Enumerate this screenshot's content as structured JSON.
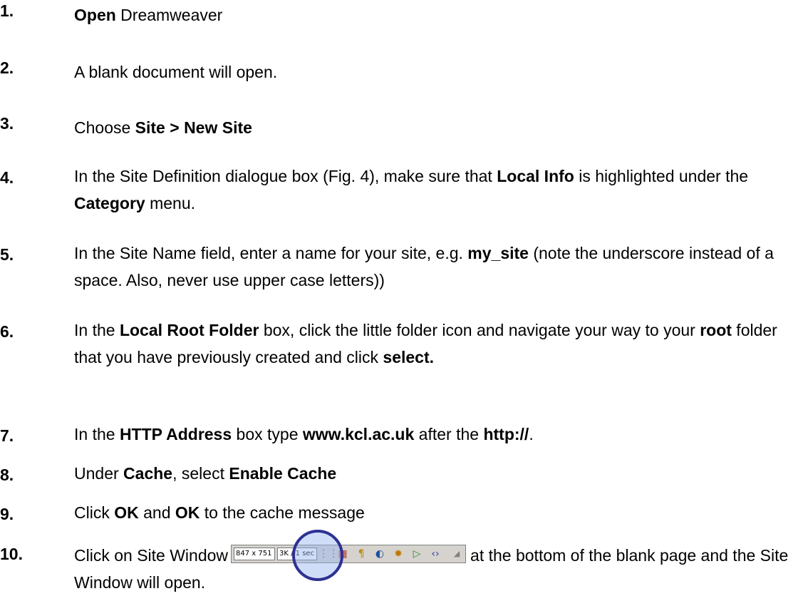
{
  "steps": [
    {
      "num": "1.",
      "parts": [
        {
          "b": "Open"
        },
        {
          "t": " Dreamweaver"
        }
      ]
    },
    {
      "num": "2.",
      "parts": [
        {
          "t": "A blank document will open."
        }
      ]
    },
    {
      "num": "3.",
      "parts": [
        {
          "t": "Choose "
        },
        {
          "b": "Site > New Site"
        }
      ]
    },
    {
      "num": "4.",
      "parts": [
        {
          "t": "In the Site Definition dialogue box (Fig. 4), make sure that "
        },
        {
          "b": "Local Info"
        },
        {
          "t": " is highlighted under the "
        },
        {
          "b": "Category"
        },
        {
          "t": " menu."
        }
      ]
    },
    {
      "num": "5.",
      "parts": [
        {
          "t": "In the Site Name field, enter a name for your site, e.g. "
        },
        {
          "b": "my_site"
        },
        {
          "t": " (note the underscore instead of a space. Also, never use upper case letters))"
        }
      ]
    },
    {
      "num": "6.",
      "parts": [
        {
          "t": "In the "
        },
        {
          "b": "Local Root Folder"
        },
        {
          "t": " box, click the little folder icon and navigate your way to your "
        },
        {
          "b": "root"
        },
        {
          "t": " folder that you have previously created and click "
        },
        {
          "b": "select."
        }
      ]
    },
    {
      "num": "7.",
      "parts": [
        {
          "t": "In the "
        },
        {
          "b": "HTTP Address"
        },
        {
          "t": " box type "
        },
        {
          "b": "www.kcl.ac.uk"
        },
        {
          "t": " after the "
        },
        {
          "b": "http://"
        },
        {
          "t": "."
        }
      ]
    },
    {
      "num": "8.",
      "parts": [
        {
          "t": "Under "
        },
        {
          "b": "Cache"
        },
        {
          "t": ", select "
        },
        {
          "b": "Enable Cache"
        }
      ]
    },
    {
      "num": "9.",
      "parts": [
        {
          "t": "Click "
        },
        {
          "b": "OK"
        },
        {
          "t": " and "
        },
        {
          "b": "OK"
        },
        {
          "t": " to the cache message"
        }
      ]
    }
  ],
  "step10": {
    "num": "10.",
    "before": "Click on Site Window",
    "after": "at the bottom of the blank page and the Site Window will open."
  },
  "toolbar": {
    "size_field": "847 x 751 ▾",
    "speed_field": "3K / 1 sec"
  },
  "colors": {
    "highlight_circle": "#2e3192",
    "toolbar_bg": "#d6d3ce"
  }
}
